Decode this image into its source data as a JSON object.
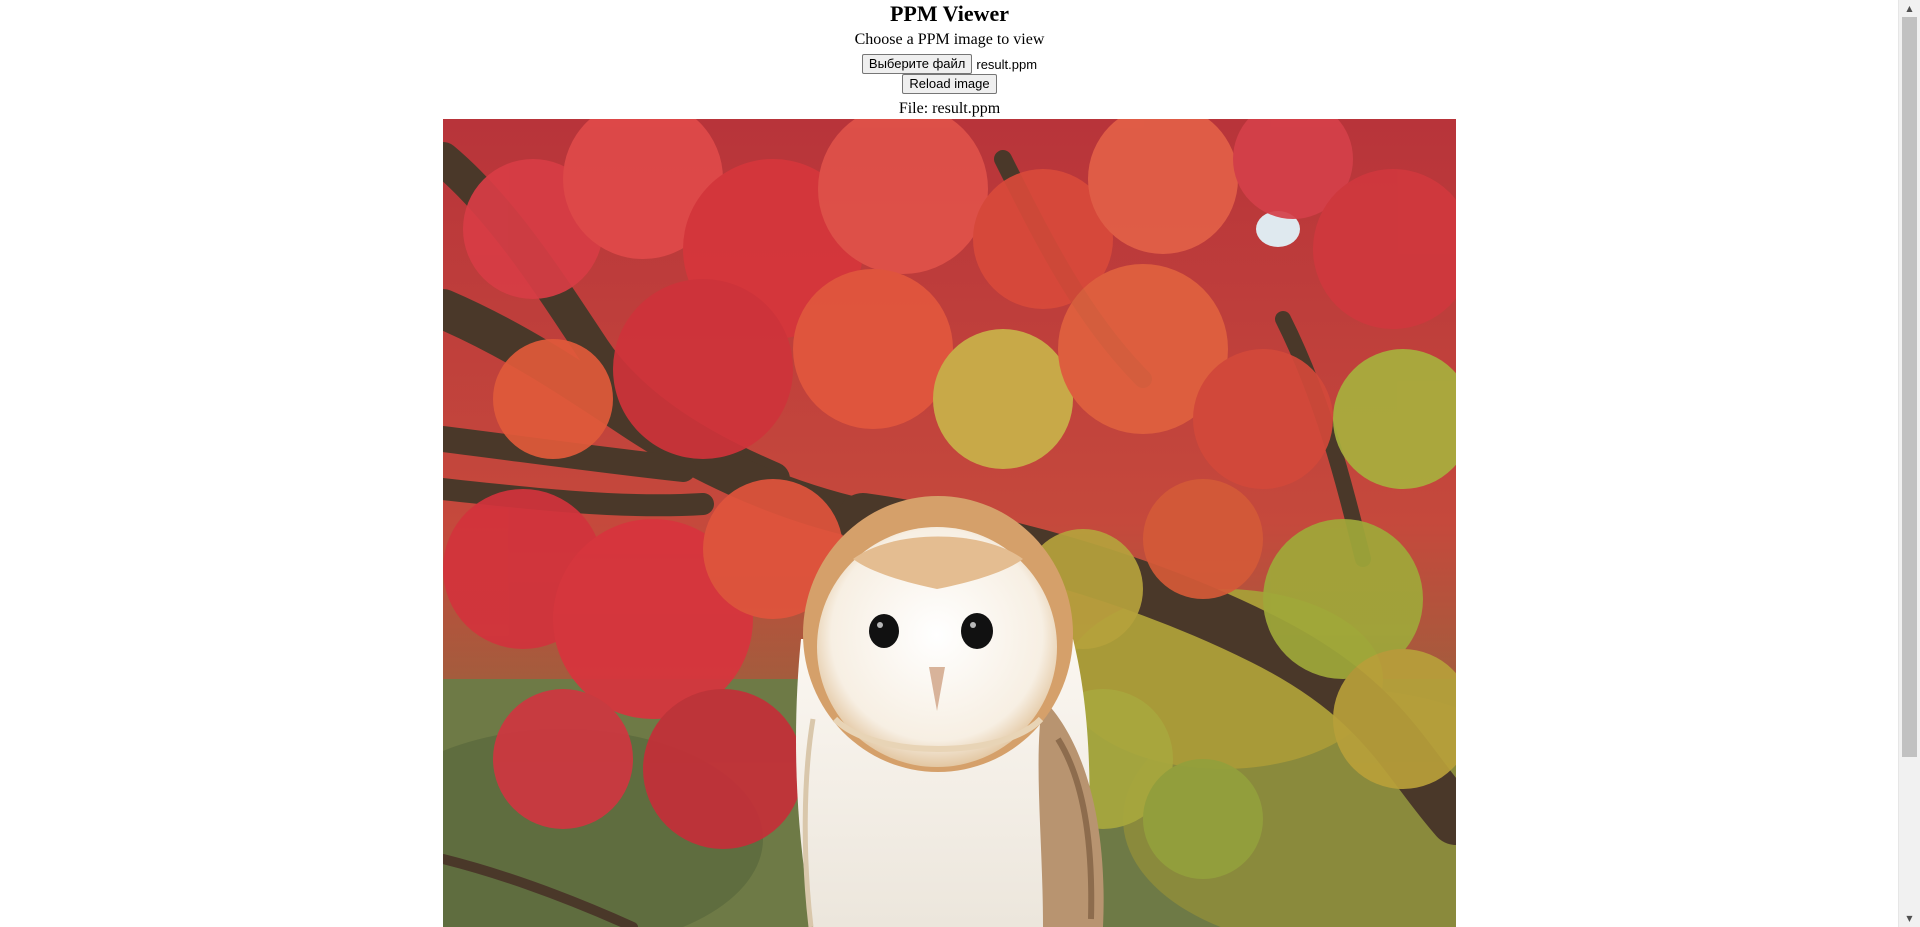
{
  "title": "PPM Viewer",
  "subtitle": "Choose a PPM image to view",
  "file_input": {
    "button_label": "Выберите файл",
    "selected_file": "result.ppm"
  },
  "reload_button_label": "Reload image",
  "file_label": "File: result.ppm",
  "image": {
    "subject": "barn owl on branch under red and orange maple leaves"
  },
  "scrollbar": {
    "up_icon": "triangle-up",
    "down_icon": "triangle-down"
  },
  "colors": {
    "leaf_red": "#d63a3f",
    "leaf_orange": "#e0652e",
    "leaf_green": "#9aa53a",
    "branch": "#4e3a2a",
    "owl_face": "#fbf6ee",
    "owl_rim": "#d9a874",
    "owl_wing": "#b89470"
  }
}
